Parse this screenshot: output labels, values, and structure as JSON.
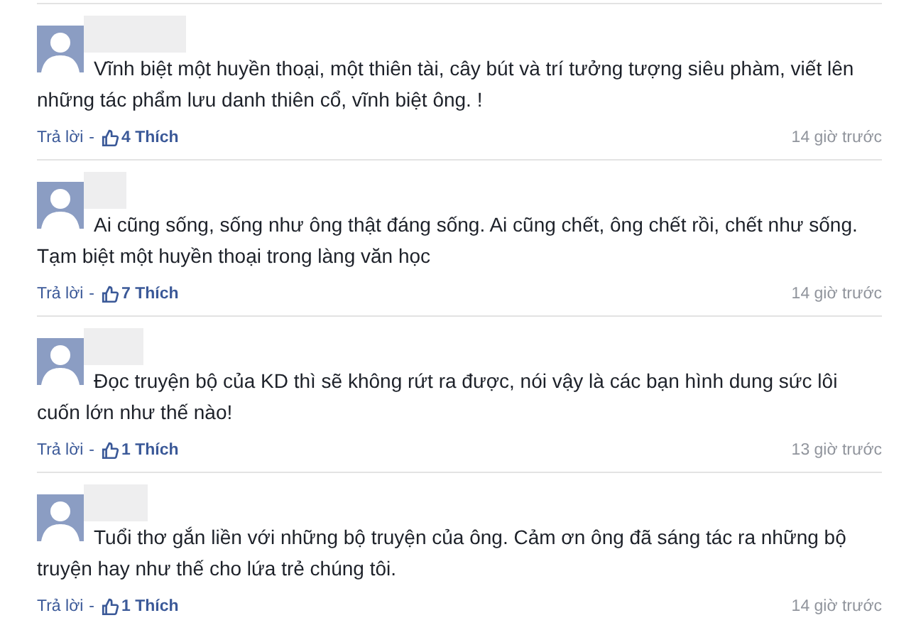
{
  "comments": [
    {
      "text": "Vĩnh biệt một huyền thoại, một thiên tài, cây bút và trí tưởng tượng siêu phàm, viết lên những tác phẩm lưu danh thiên cổ, vĩnh biệt ông. !",
      "reply": "Trả lời",
      "separator": "-",
      "likes": "4 Thích",
      "time": "14 giờ trước"
    },
    {
      "text": "Ai cũng sống, sống như ông thật đáng sống. Ai cũng chết, ông chết rồi, chết như sống. Tạm biệt một huyền thoại trong làng văn học",
      "reply": "Trả lời",
      "separator": "-",
      "likes": "7 Thích",
      "time": "14 giờ trước"
    },
    {
      "text": "Đọc truyện bộ của KD thì sẽ không rứt ra được, nói vậy là các bạn hình dung sức lôi cuốn lớn như thế nào!",
      "reply": "Trả lời",
      "separator": "-",
      "likes": "1 Thích",
      "time": "13 giờ trước"
    },
    {
      "text": "Tuổi thơ gắn liền với những bộ truyện của ông. Cảm ơn ông đã sáng tác ra những bộ truyện hay như thế cho lứa trẻ chúng tôi.",
      "reply": "Trả lời",
      "separator": "-",
      "likes": "1 Thích",
      "time": "14 giờ trước"
    }
  ]
}
